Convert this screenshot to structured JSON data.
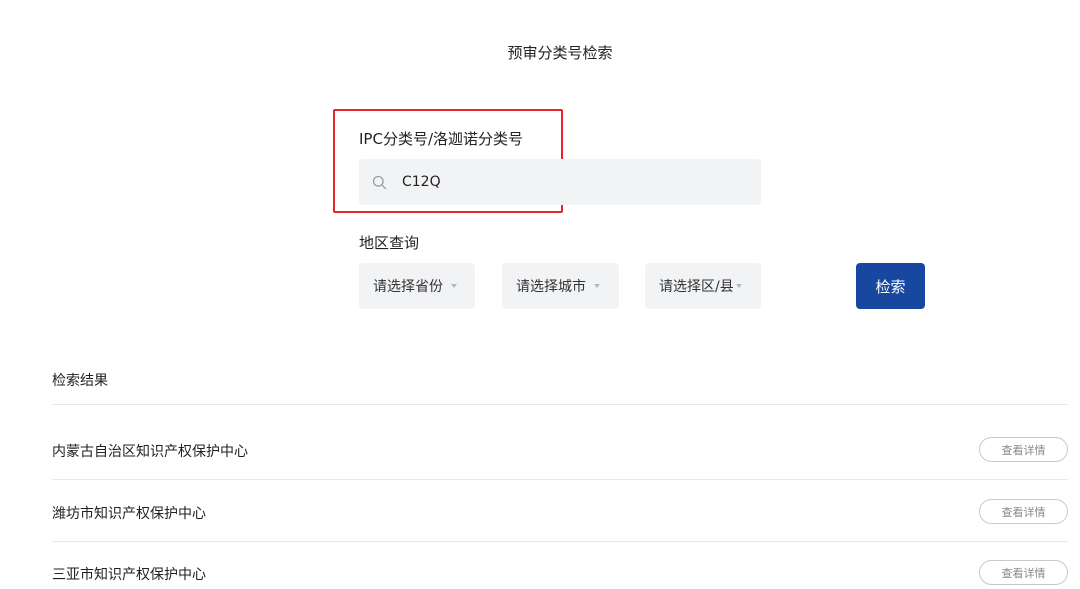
{
  "page": {
    "title": "预审分类号检索"
  },
  "ipc": {
    "label": "IPC分类号/洛迦诺分类号",
    "search_value": "C12Q",
    "search_icon": "search-icon"
  },
  "region": {
    "label": "地区查询",
    "province_placeholder": "请选择省份",
    "city_placeholder": "请选择城市",
    "district_placeholder": "请选择区/县"
  },
  "search_button": {
    "label": "检索",
    "color": "#17479e"
  },
  "highlight": {
    "color": "#e5242b"
  },
  "results": {
    "title": "检索结果",
    "detail_label": "查看详情",
    "items": [
      {
        "name": "内蒙古自治区知识产权保护中心"
      },
      {
        "name": "潍坊市知识产权保护中心"
      },
      {
        "name": "三亚市知识产权保护中心"
      }
    ]
  }
}
